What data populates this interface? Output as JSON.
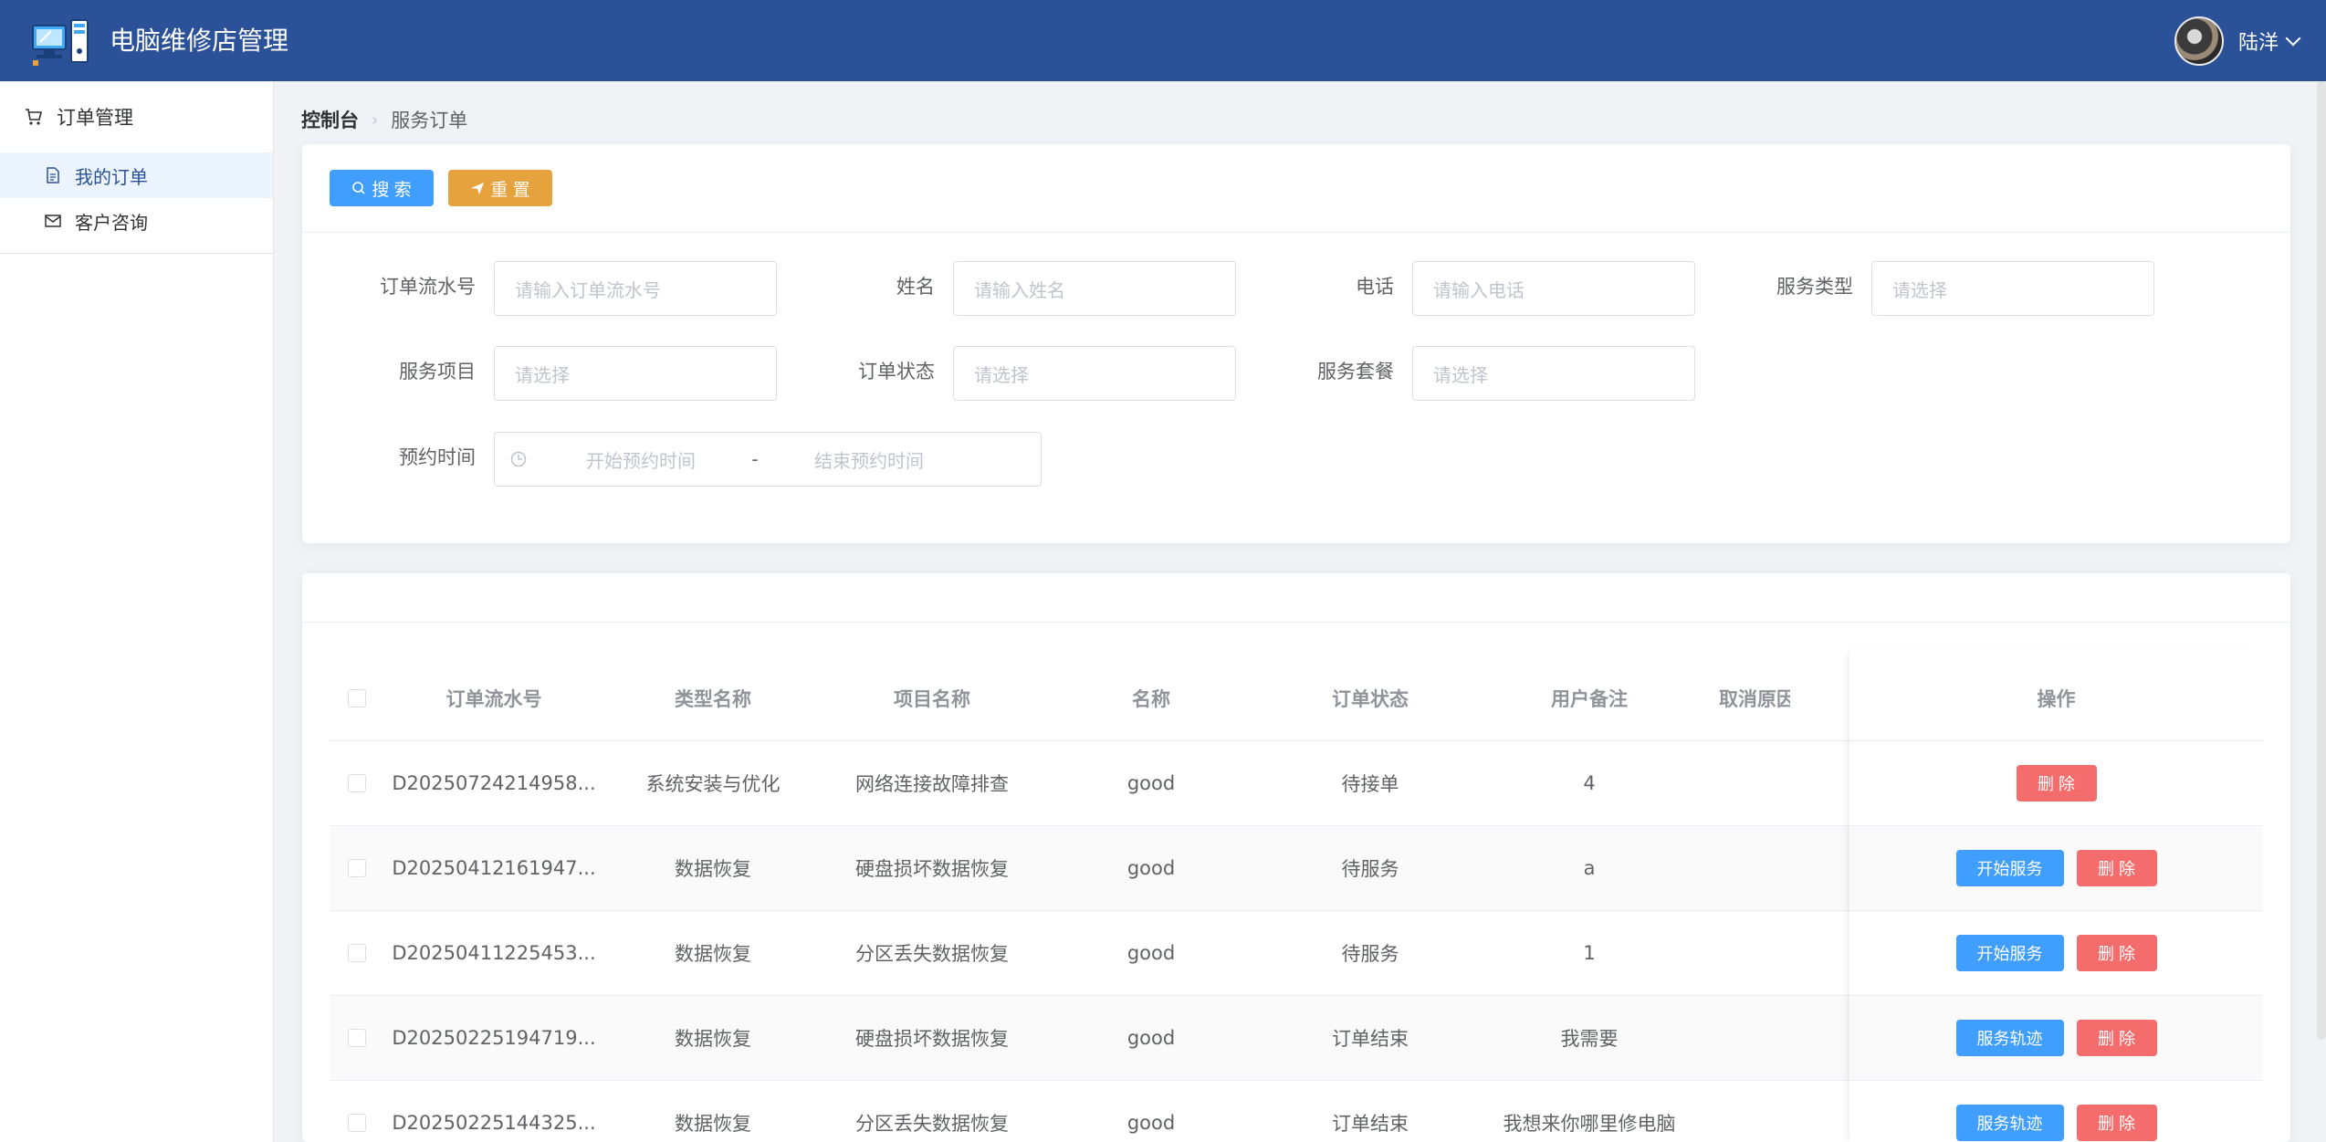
{
  "app": {
    "title": "电脑维修店管理"
  },
  "user": {
    "name": "陆洋"
  },
  "sidebar": {
    "group": "订单管理",
    "items": [
      {
        "label": "我的订单",
        "active": true
      },
      {
        "label": "客户咨询",
        "active": false
      }
    ]
  },
  "breadcrumb": {
    "root": "控制台",
    "current": "服务订单"
  },
  "toolbar": {
    "search_label": "搜 索",
    "reset_label": "重 置"
  },
  "filters": {
    "order_no": {
      "label": "订单流水号",
      "placeholder": "请输入订单流水号"
    },
    "name": {
      "label": "姓名",
      "placeholder": "请输入姓名"
    },
    "phone": {
      "label": "电话",
      "placeholder": "请输入电话"
    },
    "service_type": {
      "label": "服务类型",
      "placeholder": "请选择"
    },
    "service_item": {
      "label": "服务项目",
      "placeholder": "请选择"
    },
    "order_status": {
      "label": "订单状态",
      "placeholder": "请选择"
    },
    "package": {
      "label": "服务套餐",
      "placeholder": "请选择"
    },
    "appointment": {
      "label": "预约时间",
      "start_placeholder": "开始预约时间",
      "separator": "-",
      "end_placeholder": "结束预约时间"
    }
  },
  "table": {
    "columns": [
      "订单流水号",
      "类型名称",
      "项目名称",
      "名称",
      "订单状态",
      "用户备注",
      "取消原因",
      "操作"
    ],
    "rows": [
      {
        "sn": "D20250724214958...",
        "type": "系统安装与优化",
        "item": "网络连接故障排查",
        "name": "good",
        "status": "待接单",
        "remark": "4",
        "actions": [
          "删 除"
        ]
      },
      {
        "sn": "D20250412161947...",
        "type": "数据恢复",
        "item": "硬盘损坏数据恢复",
        "name": "good",
        "status": "待服务",
        "remark": "a",
        "actions": [
          "开始服务",
          "删 除"
        ]
      },
      {
        "sn": "D20250411225453...",
        "type": "数据恢复",
        "item": "分区丢失数据恢复",
        "name": "good",
        "status": "待服务",
        "remark": "1",
        "actions": [
          "开始服务",
          "删 除"
        ]
      },
      {
        "sn": "D20250225194719...",
        "type": "数据恢复",
        "item": "硬盘损坏数据恢复",
        "name": "good",
        "status": "订单结束",
        "remark": "我需要",
        "actions": [
          "服务轨迹",
          "删 除"
        ]
      },
      {
        "sn": "D20250225144325...",
        "type": "数据恢复",
        "item": "分区丢失数据恢复",
        "name": "good",
        "status": "订单结束",
        "remark": "我想来你哪里修电脑",
        "actions": [
          "服务轨迹",
          "删 除"
        ]
      }
    ]
  },
  "colors": {
    "header": "#2b5298",
    "primary": "#409eff",
    "warning": "#e6a23c",
    "danger": "#f56c6c"
  }
}
